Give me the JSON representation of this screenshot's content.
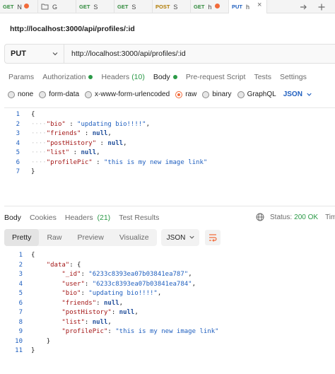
{
  "tabs": [
    {
      "method": "GET",
      "label": "N",
      "dot": true
    },
    {
      "method": "",
      "label": "G",
      "icon": "folder-icon",
      "dot": false
    },
    {
      "method": "GET",
      "label": "S",
      "dot": false
    },
    {
      "method": "GET",
      "label": "S",
      "dot": false
    },
    {
      "method": "POST",
      "label": "S",
      "dot": false
    },
    {
      "method": "GET",
      "label": "h",
      "dot": true
    },
    {
      "method": "PUT",
      "label": "h",
      "dot": true,
      "active": true
    }
  ],
  "request": {
    "title": "http://localhost:3000/api/profiles/:id",
    "method": "PUT",
    "url": "http://localhost:3000/api/profiles/:id"
  },
  "request_tabs": {
    "params": "Params",
    "authorization": "Authorization",
    "headers": "Headers",
    "headers_count": "(10)",
    "body": "Body",
    "prerequest": "Pre-request Script",
    "tests": "Tests",
    "settings": "Settings"
  },
  "body_types": {
    "none": "none",
    "form_data": "form-data",
    "urlencoded": "x-www-form-urlencoded",
    "raw": "raw",
    "binary": "binary",
    "graphql": "GraphQL",
    "format": "JSON"
  },
  "request_body": {
    "line_numbers": [
      "1",
      "2",
      "3",
      "4",
      "5",
      "6",
      "7"
    ],
    "open": "{",
    "close": "}",
    "fields": [
      {
        "key": "\"bio\"",
        "sep": " : ",
        "value": "\"updating bio!!!!\"",
        "vtype": "s",
        "end": ","
      },
      {
        "key": "\"friends\"",
        "sep": " : ",
        "value": "null",
        "vtype": "kw",
        "end": ","
      },
      {
        "key": "\"postHistory\"",
        "sep": " : ",
        "value": "null",
        "vtype": "kw",
        "end": ","
      },
      {
        "key": "\"list\"",
        "sep": " : ",
        "value": "null",
        "vtype": "kw",
        "end": ","
      },
      {
        "key": "\"profilePic\"",
        "sep": " : ",
        "value": "\"this is my new image link\"",
        "vtype": "s",
        "end": ""
      }
    ]
  },
  "response_tabs": {
    "body": "Body",
    "cookies": "Cookies",
    "headers": "Headers",
    "headers_count": "(21)",
    "test_results": "Test Results"
  },
  "response_meta": {
    "status_label": "Status:",
    "status_value": "200 OK",
    "time_label": "Time:"
  },
  "response_view": {
    "pretty": "Pretty",
    "raw": "Raw",
    "preview": "Preview",
    "visualize": "Visualize",
    "format": "JSON"
  },
  "response_body": {
    "line_numbers": [
      "1",
      "2",
      "3",
      "4",
      "5",
      "6",
      "7",
      "8",
      "9",
      "10",
      "11"
    ],
    "lines": [
      {
        "indent": "",
        "parts": [
          {
            "t": "{",
            "c": "p"
          }
        ]
      },
      {
        "indent": "    ",
        "parts": [
          {
            "t": "\"data\"",
            "c": "k"
          },
          {
            "t": ": {",
            "c": "p"
          }
        ]
      },
      {
        "indent": "        ",
        "parts": [
          {
            "t": "\"_id\"",
            "c": "k"
          },
          {
            "t": ": ",
            "c": "p"
          },
          {
            "t": "\"6233c8393ea07b03841ea787\"",
            "c": "s"
          },
          {
            "t": ",",
            "c": "p"
          }
        ]
      },
      {
        "indent": "        ",
        "parts": [
          {
            "t": "\"user\"",
            "c": "k"
          },
          {
            "t": ": ",
            "c": "p"
          },
          {
            "t": "\"6233c8393ea07b03841ea784\"",
            "c": "s"
          },
          {
            "t": ",",
            "c": "p"
          }
        ]
      },
      {
        "indent": "        ",
        "parts": [
          {
            "t": "\"bio\"",
            "c": "k"
          },
          {
            "t": ": ",
            "c": "p"
          },
          {
            "t": "\"updating bio!!!!\"",
            "c": "s"
          },
          {
            "t": ",",
            "c": "p"
          }
        ]
      },
      {
        "indent": "        ",
        "parts": [
          {
            "t": "\"friends\"",
            "c": "k"
          },
          {
            "t": ": ",
            "c": "p"
          },
          {
            "t": "null",
            "c": "kw"
          },
          {
            "t": ",",
            "c": "p"
          }
        ]
      },
      {
        "indent": "        ",
        "parts": [
          {
            "t": "\"postHistory\"",
            "c": "k"
          },
          {
            "t": ": ",
            "c": "p"
          },
          {
            "t": "null",
            "c": "kw"
          },
          {
            "t": ",",
            "c": "p"
          }
        ]
      },
      {
        "indent": "        ",
        "parts": [
          {
            "t": "\"list\"",
            "c": "k"
          },
          {
            "t": ": ",
            "c": "p"
          },
          {
            "t": "null",
            "c": "kw"
          },
          {
            "t": ",",
            "c": "p"
          }
        ]
      },
      {
        "indent": "        ",
        "parts": [
          {
            "t": "\"profilePic\"",
            "c": "k"
          },
          {
            "t": ": ",
            "c": "p"
          },
          {
            "t": "\"this is my new image link\"",
            "c": "s"
          }
        ]
      },
      {
        "indent": "    ",
        "parts": [
          {
            "t": "}",
            "c": "p"
          }
        ]
      },
      {
        "indent": "",
        "parts": [
          {
            "t": "}",
            "c": "p"
          }
        ]
      }
    ]
  },
  "colors": {
    "accent": "#f26b3a",
    "success": "#2b9a47",
    "link": "#1f5fbf",
    "json_key": "#a31515"
  }
}
